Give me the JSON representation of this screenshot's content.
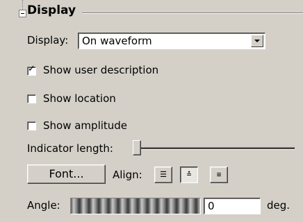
{
  "group": {
    "title": "Display"
  },
  "display": {
    "label": "Display:",
    "value": "On waveform"
  },
  "checkboxes": [
    {
      "label": "Show user description",
      "checked": true
    },
    {
      "label": "Show location",
      "checked": false
    },
    {
      "label": "Show amplitude",
      "checked": false
    }
  ],
  "indicator": {
    "label": "Indicator length:",
    "value": 0.0
  },
  "font_button": {
    "label": "Font..."
  },
  "align": {
    "label": "Align:",
    "options": [
      "left",
      "center",
      "right"
    ],
    "selected": "center"
  },
  "angle": {
    "label": "Angle:",
    "value": "0",
    "unit": "deg."
  }
}
